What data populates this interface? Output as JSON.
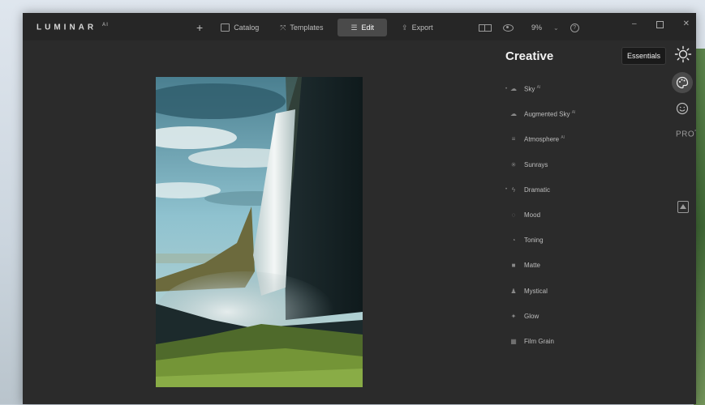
{
  "app": {
    "logo_text": "LUMINAR",
    "logo_sup": "AI"
  },
  "topnav": {
    "add_label": "+",
    "items": [
      {
        "label": "Catalog",
        "icon": "folder-icon"
      },
      {
        "label": "Templates",
        "icon": "templates-icon"
      },
      {
        "label": "Edit",
        "icon": "edit-sliders-icon"
      },
      {
        "label": "Export",
        "icon": "export-icon"
      }
    ],
    "active": "Edit"
  },
  "view": {
    "zoom": "9%",
    "zoom_chevron": "⌄",
    "help": "?"
  },
  "window_controls": {
    "minimize": "–",
    "close": "✕"
  },
  "panel": {
    "title": "Creative",
    "tools": [
      {
        "label": "Sky",
        "ai": "AI",
        "icon": "cloud-icon",
        "expandable": true
      },
      {
        "label": "Augmented Sky",
        "ai": "AI",
        "icon": "augmented-sky-icon"
      },
      {
        "label": "Atmosphere",
        "ai": "AI",
        "icon": "atmosphere-icon"
      },
      {
        "label": "Sunrays",
        "icon": "sunrays-icon"
      },
      {
        "label": "Dramatic",
        "icon": "dramatic-icon",
        "expandable": true
      },
      {
        "label": "Mood",
        "icon": "mood-icon"
      },
      {
        "label": "Toning",
        "icon": "toning-icon"
      },
      {
        "label": "Matte",
        "icon": "matte-icon"
      },
      {
        "label": "Mystical",
        "icon": "mystical-icon"
      },
      {
        "label": "Glow",
        "icon": "glow-icon"
      },
      {
        "label": "Film Grain",
        "icon": "film-grain-icon"
      }
    ]
  },
  "sidebar": {
    "tooltip": "Essentials",
    "pro_label": "PRO",
    "pro_sup": "*"
  },
  "colors": {
    "window_bg": "#2b2b2b",
    "titlebar_bg": "#262626",
    "active_tab_bg": "#4a4a4a"
  }
}
